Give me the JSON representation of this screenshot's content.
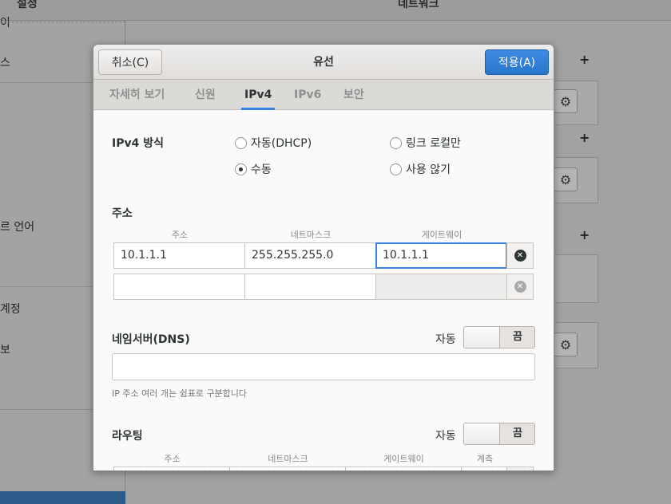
{
  "background": {
    "sidebar_title": "설정",
    "main_title": "네트워크",
    "sidebar_items": [
      "이",
      "스",
      "르 언어",
      "계정",
      "보"
    ],
    "gear_icon": "gear-icon",
    "plus_glyph": "+"
  },
  "dialog": {
    "title": "유선",
    "cancel_label": "취소(C)",
    "apply_label": "적용(A)",
    "accent_color": "#3584e4",
    "tabs": [
      {
        "label": "자세히 보기",
        "active": false
      },
      {
        "label": "신원",
        "active": false
      },
      {
        "label": "IPv4",
        "active": true
      },
      {
        "label": "IPv6",
        "active": false
      },
      {
        "label": "보안",
        "active": false
      }
    ]
  },
  "ipv4": {
    "method_label": "IPv4 방식",
    "methods": [
      {
        "label": "자동(DHCP)",
        "selected": false
      },
      {
        "label": "링크 로컬만",
        "selected": false
      },
      {
        "label": "수동",
        "selected": true
      },
      {
        "label": "사용 않기",
        "selected": false
      }
    ],
    "addresses": {
      "section_label": "주소",
      "columns": [
        "주소",
        "네트마스크",
        "게이트웨이"
      ],
      "rows": [
        {
          "address": "10.1.1.1",
          "netmask": "255.255.255.0",
          "gateway": "10.1.1.1"
        },
        {
          "address": "",
          "netmask": "",
          "gateway": ""
        }
      ]
    },
    "dns": {
      "section_label": "네임서버(DNS)",
      "auto_label": "자동",
      "switch_state": "끔",
      "value": "",
      "hint": "IP 주소 여러 개는 쉼표로 구분합니다"
    },
    "routes": {
      "section_label": "라우팅",
      "auto_label": "자동",
      "switch_state": "끔",
      "columns": [
        "주소",
        "네트마스크",
        "게이트웨이",
        "계측"
      ]
    }
  }
}
